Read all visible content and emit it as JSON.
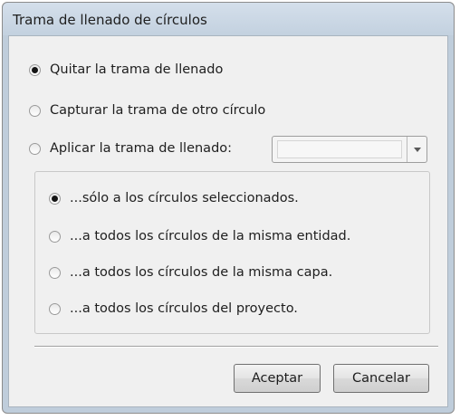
{
  "window": {
    "title": "Trama de llenado de círculos"
  },
  "mode_options": [
    {
      "label": "Quitar la trama de llenado",
      "checked": true
    },
    {
      "label": "Capturar la trama de otro círculo",
      "checked": false
    },
    {
      "label": "Aplicar la trama de llenado:",
      "checked": false
    }
  ],
  "pattern_dropdown": {
    "value": ""
  },
  "scope_options": [
    {
      "label": "...sólo a los círculos seleccionados.",
      "checked": true
    },
    {
      "label": "...a todos los círculos de la misma entidad.",
      "checked": false
    },
    {
      "label": "...a todos los círculos de la misma capa.",
      "checked": false
    },
    {
      "label": "...a todos los círculos del proyecto.",
      "checked": false
    }
  ],
  "buttons": {
    "accept_label": "Aceptar",
    "cancel_label": "Cancelar"
  }
}
